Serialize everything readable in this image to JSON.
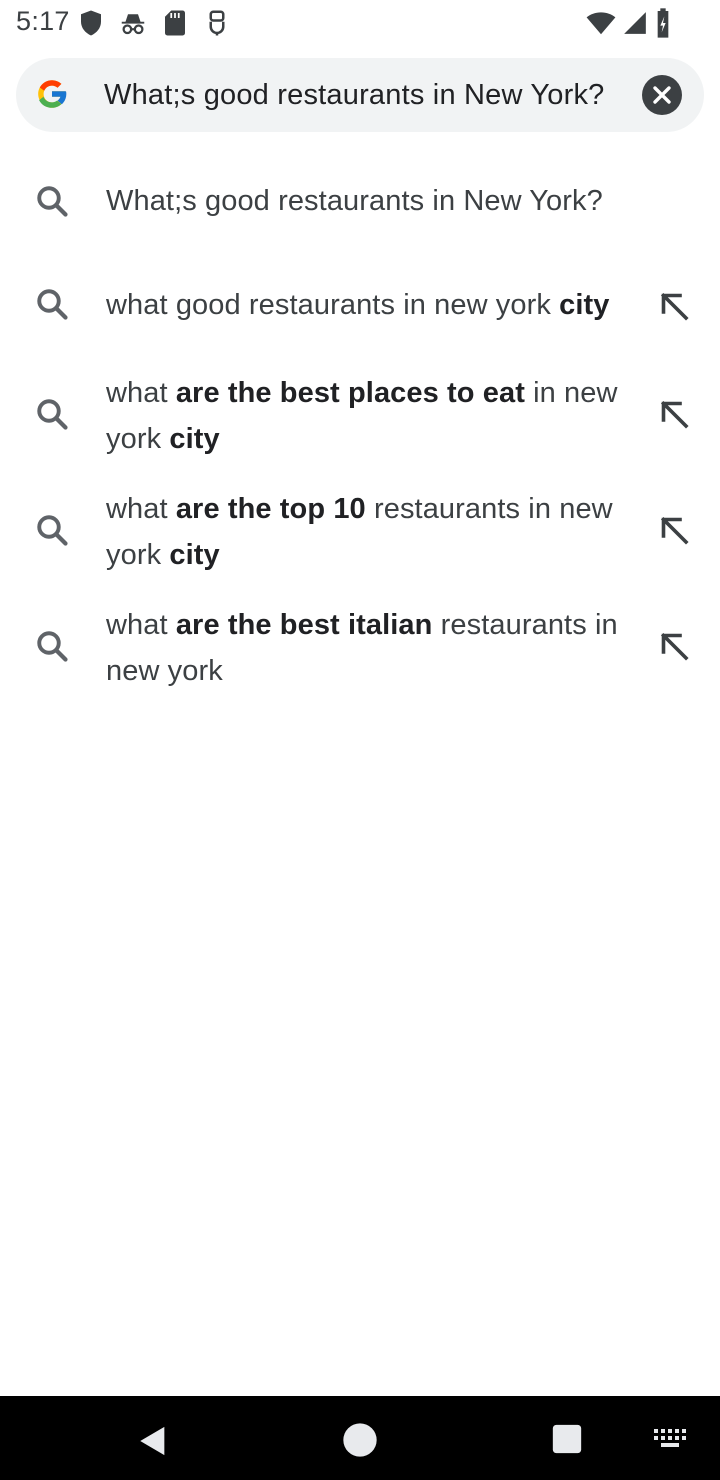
{
  "status_bar": {
    "time": "5:17",
    "left_icons": [
      "shield-icon",
      "incognito-icon",
      "sd-card-icon",
      "usb-icon"
    ],
    "right_icons": [
      "wifi-icon",
      "signal-icon",
      "battery-icon"
    ]
  },
  "search": {
    "value": "What;s good restaurants in New York?",
    "clear_icon": "close-icon",
    "logo": "google-g-icon"
  },
  "suggestions": [
    {
      "parts": [
        {
          "text": "What;s good restaurants in New York?",
          "bold": false
        }
      ],
      "fill_arrow": false
    },
    {
      "parts": [
        {
          "text": "what good restaurants in new york ",
          "bold": false
        },
        {
          "text": "city",
          "bold": true
        }
      ],
      "fill_arrow": true
    },
    {
      "parts": [
        {
          "text": "what ",
          "bold": false
        },
        {
          "text": "are the best places to eat",
          "bold": true
        },
        {
          "text": " in new york ",
          "bold": false
        },
        {
          "text": "city",
          "bold": true
        }
      ],
      "fill_arrow": true
    },
    {
      "parts": [
        {
          "text": "what ",
          "bold": false
        },
        {
          "text": "are the top 10",
          "bold": true
        },
        {
          "text": " restaurants in new york ",
          "bold": false
        },
        {
          "text": "city",
          "bold": true
        }
      ],
      "fill_arrow": true
    },
    {
      "parts": [
        {
          "text": "what ",
          "bold": false
        },
        {
          "text": "are the best italian",
          "bold": true
        },
        {
          "text": " restaurants in new york",
          "bold": false
        }
      ],
      "fill_arrow": true
    }
  ],
  "nav_bar": {
    "buttons": [
      "back-icon",
      "home-icon",
      "recents-icon",
      "keyboard-icon"
    ]
  },
  "colors": {
    "search_bg": "#f1f3f4",
    "text": "#3c4043",
    "icon": "#5f6368",
    "nav_bg": "#000000"
  }
}
